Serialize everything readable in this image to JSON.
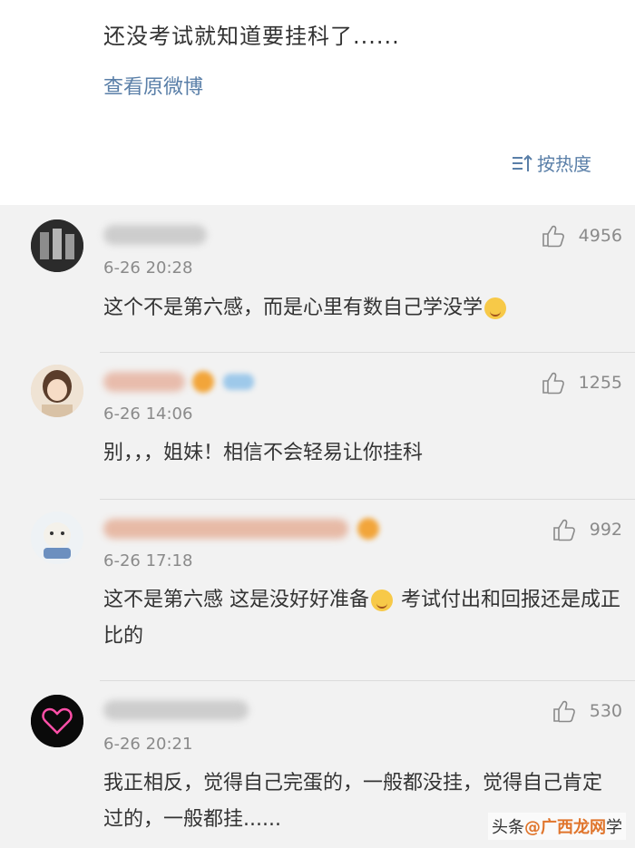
{
  "post": {
    "text": "还没考试就知道要挂科了......",
    "view_original": "查看原微博",
    "sort_label": "按热度"
  },
  "comments": [
    {
      "time": "6-26 20:28",
      "likes": "4956",
      "text": "这个不是第六感，而是心里有数自己学没学",
      "emoji": "yum-face"
    },
    {
      "time": "6-26 14:06",
      "likes": "1255",
      "text": "别，，，姐妹！相信不会轻易让你挂科"
    },
    {
      "time": "6-26 17:18",
      "likes": "992",
      "text_a": "这不是第六感 这是没好好准备",
      "text_b": " 考试付出和回报还是成正比的",
      "emoji": "laugh-tears"
    },
    {
      "time": "6-26 20:21",
      "likes": "530",
      "text": "我正相反，觉得自己完蛋的，一般都没挂，觉得自己肯定过的，一般都挂......"
    }
  ],
  "watermark": {
    "prefix": "头条",
    "brand": "@广西龙网",
    "suffix": "学"
  },
  "colors": {
    "link": "#5a7fa8",
    "text": "#333333",
    "meta": "#8a8a8a",
    "background": "#f2f2f2"
  }
}
